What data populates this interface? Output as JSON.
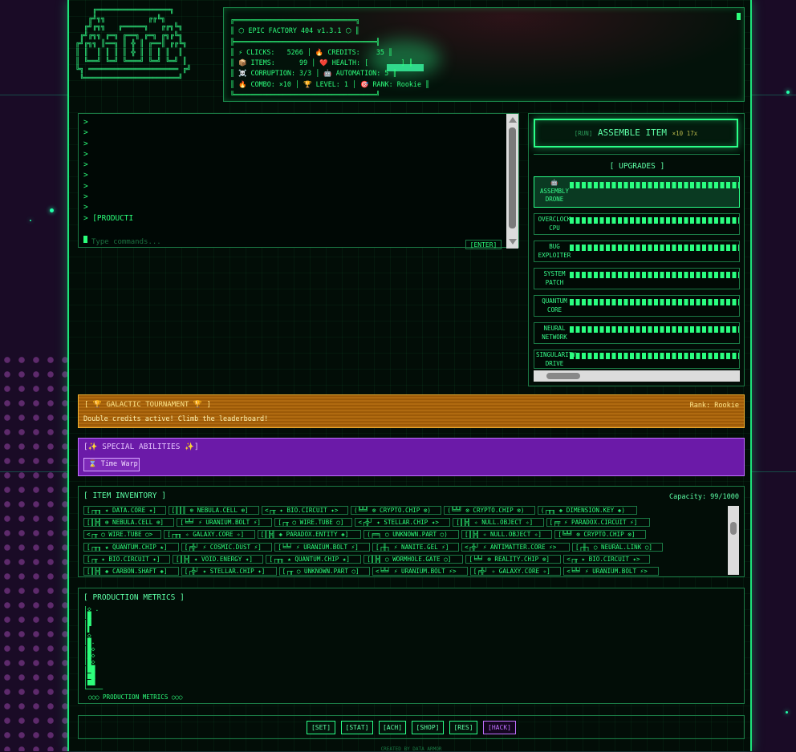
{
  "header": {
    "ascii_logo": "    ╔═════════════════╗\n   ╔╝╗╗          ╔╔╚╗\n  ╔╝╔╗╗   ╔═════╗   ╔╔╗╚╗\n ╔╝╔╗╗ ╔═╗ ╔══╗ ╔═╗ ╔╗╔╚╗\n╔╝╔╗╗ ║══╗ ║ ╬ ║ ╔══║ ╔╔╚╗\n║ ║  ║ ║ ║ ║ ╬ ║ ║ ║ ║  ║\n║ ╚══╝ ╚═╝ ╚═══╝ ╚═╝ ╚═╝ ║\n╚╗ ═════════════════════ ╔╝\n ╚══════════════════════╝",
    "status_box": "╔══════════════════════════════╗\n║ ⬡ EPIC FACTORY 404 v1.3.1 ⬡ ║\n╠═══════════════════════════════════╣\n║ ⚡ CLICKS:   5266 │ 🔥 CREDITS:    35 ║\n║ 📦 ITEMS:      99 │ ❤️ HEALTH: [        ] ║\n║ ☠️ CORRUPTION: 3/3 │ 🤖 AUTOMATION: 5 ║\n║ 🔥 COMBO: ×10 │ 🏆 LEVEL: 1 │ 🎯 RANK: Rookie ║\n╚═══════════════════════════════════╝"
  },
  "terminal": {
    "lines": ">\n>\n>\n>\n>\n>\n>\n>\n>\n> [PRODUCTI",
    "placeholder": "Type commands...",
    "enter_label": "[ENTER]"
  },
  "assemble": {
    "run": "[RUN]",
    "label": "ASSEMBLE ITEM",
    "mult": "×10 17x"
  },
  "upgrades": {
    "title": "[ UPGRADES ]",
    "items": [
      {
        "label": "🤖\nASSEMBLY\nDRONE"
      },
      {
        "label": "OVERCLOCK\nCPU"
      },
      {
        "label": "BUG\nEXPLOITER"
      },
      {
        "label": "SYSTEM\nPATCH"
      },
      {
        "label": "QUANTUM\nCORE"
      },
      {
        "label": "NEURAL\nNETWORK"
      },
      {
        "label": "SINGULARITY\nDRIVE"
      }
    ]
  },
  "tournament": {
    "title": "[ 🏆 GALACTIC TOURNAMENT 🏆 ]",
    "rank": "Rank: Rookie",
    "subtitle": "Double credits active! Climb the leaderboard!"
  },
  "abilities": {
    "title": "[✨ SPECIAL ABILITIES ✨]",
    "time_warp": "⌛ Time Warp"
  },
  "inventory": {
    "title": "[ ITEM INVENTORY ]",
    "capacity": "Capacity: 99/1000",
    "rows": [
      [
        "[┌╥╖ ✦ DATA.CORE ✦]",
        "[║║║ ⊕ NEBULA.CELL ⊕]",
        "<┌╥ ✦ BIO.CIRCUIT ✦>",
        "(╚╩╝ ⊗ CRYPTO.CHIP ⊗)",
        "(╚╩╝ ⊗ CRYPTO.CHIP ⊗)",
        "(┌╥╖ ◈ DIMENSION.KEY ◈)"
      ],
      [
        "[║╠╣ ⊕ NEBULA.CELL ⊕]",
        "[╘╩╛ ⚡ URANIUM.BOLT ⚡]",
        "[┌╥ ◯ WIRE.TUBE ◯]",
        "<┌╬┘ ✦ STELLAR.CHIP ✦>",
        "[║╠╣ ✧ NULL.OBJECT ✧]",
        "[╒╤ ⚡ PARADOX.CIRCUIT ⚡]"
      ],
      [
        "<┌╥ ◯ WIRE.TUBE ◯>",
        "[┌╥╖ ✧ GALAXY.CORE ✧]",
        "[║╠╣ ◈ PARADOX.ENTITY ◈]",
        "(╒═╕ ◯ UNKNOWN.PART ◯)",
        "[║╠╣ ✧ NULL.OBJECT ✧]",
        "[╚╩╝ ⊗ CRYPTO.CHIP ⊗]"
      ],
      [
        "[┌╥╖ ★ QUANTUM.CHIP ★]",
        "[╒╬┘ ⚡ COSMIC.DUST ⚡]",
        "[╘╩╛ ⚡ URANIUM.BOLT ⚡]",
        "[┌╫┐ ⚡ NANITE.GEL ⚡]",
        "<┌╬┘ ⚡ ANTIMATTER.CORE ⚡>",
        "[┌╫┐ ◯ NEURAL.LINK ◯]"
      ],
      [
        "[┌╥ ✦ BIO.CIRCUIT ✦]",
        "[║╠╣ ✦ VOID.ENERGY ✦]",
        "[┌╥╖ ★ QUANTUM.CHIP ★]",
        "[║╠╣ ◯ WORMHOLE.GATE ◯]",
        "[╘╩╛ ⊗ REALITY.CHIP ⊗]",
        "<┌╥ ✦ BIO.CIRCUIT ✦>"
      ],
      [
        "[║╠╣ ◈ CARBON.SHAFT ◈]",
        "[┌╬┘ ✦ STELLAR.CHIP ✦]",
        "[┌╥ ◯ UNKNOWN.PART ◯]",
        "<╘╩╛ ⚡ URANIUM.BOLT ⚡>",
        "[╒╬┘ ✧ GALAXY.CORE ✧]",
        "<╘╩╛ ⚡ URANIUM.BOLT ⚡>"
      ]
    ]
  },
  "metrics": {
    "title": "[ PRODUCTION METRICS ]",
    "graph": "|◇ .\n|█\n|█\n|▌\n|◇\n|█.\n|█◇\n|█◇\n|█◇\n|██\n|▆█\n|▆█\n└────",
    "caption": "◯◯◯ PRODUCTION METRICS ◯◯◯"
  },
  "nav": {
    "set": "[SET]",
    "stat": "[STAT]",
    "ach": "[ACH]",
    "shop": "[SHOP]",
    "res": "[RES]",
    "hack": "[HACK]"
  },
  "footer": "CREATED BY DATA ARMOR"
}
